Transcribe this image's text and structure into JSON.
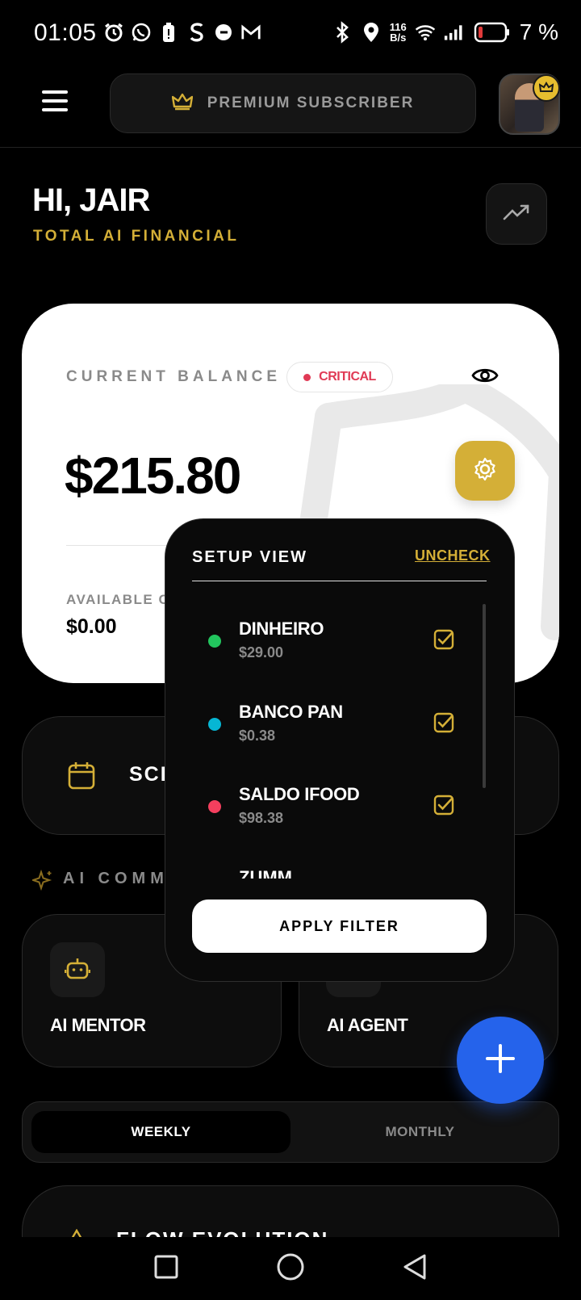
{
  "status_bar": {
    "time": "01:05",
    "net_speed_value": "116",
    "net_speed_unit": "B/s",
    "battery": "7 %"
  },
  "header": {
    "premium_label": "PREMIUM SUBSCRIBER"
  },
  "greeting": {
    "title": "HI, JAIR",
    "subtitle": "TOTAL AI FINANCIAL"
  },
  "balance_card": {
    "label": "CURRENT BALANCE",
    "status": "CRITICAL",
    "amount": "$215.80",
    "available_label": "AVAILABLE CREDIT",
    "available_value": "$0.00"
  },
  "schedule": {
    "label": "SCHEDULE"
  },
  "ai_commands": {
    "title": "AI COMMANDS",
    "mentor_label": "AI MENTOR",
    "agent_label": "AI AGENT"
  },
  "period_toggle": {
    "weekly": "WEEKLY",
    "monthly": "MONTHLY",
    "selected": "WEEKLY"
  },
  "flow": {
    "title": "FLOW EVOLUTION"
  },
  "setup_popup": {
    "title": "SETUP VIEW",
    "uncheck": "UNCHECK",
    "accounts": [
      {
        "name": "DINHEIRO",
        "value": "$29.00",
        "color": "#22c55e",
        "checked": true
      },
      {
        "name": "BANCO PAN",
        "value": "$0.38",
        "color": "#06b6d4",
        "checked": true
      },
      {
        "name": "SALDO IFOOD",
        "value": "$98.38",
        "color": "#f43f5e",
        "checked": true
      },
      {
        "name": "ZUMM",
        "value": "",
        "color": "",
        "checked": true
      }
    ],
    "apply_label": "APPLY FILTER"
  },
  "colors": {
    "gold": "#d4af37",
    "critical": "#e03a55",
    "fab_blue": "#2563eb"
  }
}
